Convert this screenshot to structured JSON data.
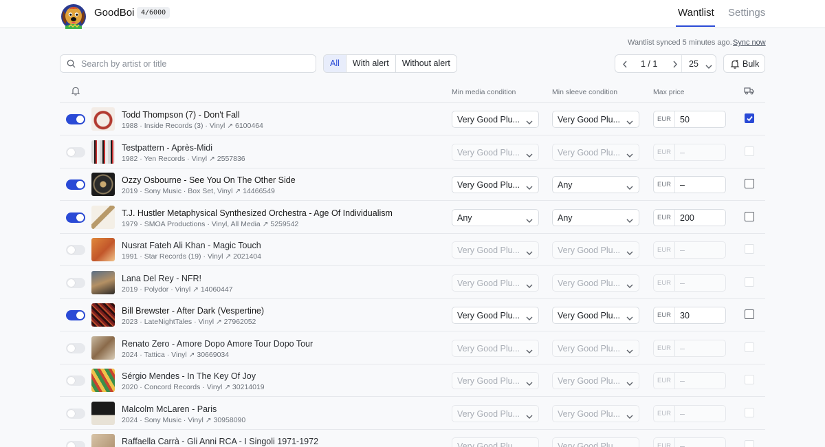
{
  "app": {
    "name": "GoodBoi",
    "quota": "4/6000",
    "nav": {
      "wantlist": "Wantlist",
      "settings": "Settings"
    }
  },
  "sync": {
    "status": "Wantlist synced 5 minutes ago.",
    "action": "Sync now"
  },
  "toolbar": {
    "search_placeholder": "Search by artist or title",
    "search_value": "",
    "filters": [
      "All",
      "With alert",
      "Without alert"
    ],
    "active_filter": "All",
    "page": "1 / 1",
    "per_page": "25",
    "bulk_label": "Bulk"
  },
  "columns": {
    "media": "Min media condition",
    "sleeve": "Min sleeve condition",
    "price": "Max price"
  },
  "rows": [
    {
      "on": true,
      "title": "Todd Thompson (7) - Don't Fall",
      "meta": "1988 · Inside Records (3) · Vinyl ↗ 6100464",
      "media": "Very Good Plu...",
      "sleeve": "Very Good Plu...",
      "currency": "EUR",
      "price": "50",
      "checked": true
    },
    {
      "on": false,
      "title": "Testpattern - Après-Midi",
      "meta": "1982 · Yen Records · Vinyl ↗ 2557836",
      "media": "Very Good Plu...",
      "sleeve": "Very Good Plu...",
      "currency": "EUR",
      "price": "–",
      "checked": false
    },
    {
      "on": true,
      "title": "Ozzy Osbourne - See You On The Other Side",
      "meta": "2019 · Sony Music · Box Set, Vinyl ↗ 14466549",
      "media": "Very Good Plu...",
      "sleeve": "Any",
      "currency": "EUR",
      "price": "–",
      "checked": false
    },
    {
      "on": true,
      "title": "T.J. Hustler Metaphysical Synthesized Orchestra - Age Of Individualism",
      "meta": "1979 · SMOA Productions · Vinyl, All Media ↗ 5259542",
      "media": "Any",
      "sleeve": "Any",
      "currency": "EUR",
      "price": "200",
      "checked": false
    },
    {
      "on": false,
      "title": "Nusrat Fateh Ali Khan - Magic Touch",
      "meta": "1991 · Star Records (19) · Vinyl ↗ 2021404",
      "media": "Very Good Plu...",
      "sleeve": "Very Good Plu...",
      "currency": "EUR",
      "price": "–",
      "checked": false
    },
    {
      "on": false,
      "title": "Lana Del Rey - NFR!",
      "meta": "2019 · Polydor · Vinyl ↗ 14060447",
      "media": "Very Good Plu...",
      "sleeve": "Very Good Plu...",
      "currency": "EUR",
      "price": "–",
      "checked": false
    },
    {
      "on": true,
      "title": "Bill Brewster - After Dark (Vespertine)",
      "meta": "2023 · LateNightTales · Vinyl ↗ 27962052",
      "media": "Very Good Plu...",
      "sleeve": "Very Good Plu...",
      "currency": "EUR",
      "price": "30",
      "checked": false
    },
    {
      "on": false,
      "title": "Renato Zero - Amore Dopo Amore Tour Dopo Tour",
      "meta": "2024 · Tattica · Vinyl ↗ 30669034",
      "media": "Very Good Plu...",
      "sleeve": "Very Good Plu...",
      "currency": "EUR",
      "price": "–",
      "checked": false
    },
    {
      "on": false,
      "title": "Sérgio Mendes - In The Key Of Joy",
      "meta": "2020 · Concord Records · Vinyl ↗ 30214019",
      "media": "Very Good Plu...",
      "sleeve": "Very Good Plu...",
      "currency": "EUR",
      "price": "–",
      "checked": false
    },
    {
      "on": false,
      "title": "Malcolm McLaren - Paris",
      "meta": "2024 · Sony Music · Vinyl ↗ 30958090",
      "media": "Very Good Plu...",
      "sleeve": "Very Good Plu...",
      "currency": "EUR",
      "price": "–",
      "checked": false
    },
    {
      "on": false,
      "title": "Raffaella Carrà - Gli Anni RCA - I Singoli 1971-1972",
      "meta": "",
      "media": "Very Good Plu...",
      "sleeve": "Very Good Plu...",
      "currency": "EUR",
      "price": "–",
      "checked": false
    }
  ],
  "colors": {
    "accent": "#2a4ad6"
  }
}
